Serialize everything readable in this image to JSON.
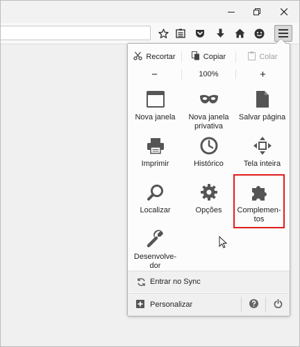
{
  "window": {
    "controls": {
      "minimize_icon": "minimize-icon",
      "restore_icon": "restore-icon",
      "close_icon": "close-icon"
    }
  },
  "toolbar": {
    "icons": [
      "star-icon",
      "reading-list-icon",
      "pocket-icon",
      "download-icon",
      "home-icon",
      "hello-icon",
      "hamburger-menu-icon"
    ]
  },
  "menu": {
    "edit": {
      "cut": "Recortar",
      "copy": "Copiar",
      "paste": "Colar"
    },
    "zoom": {
      "minus": "−",
      "value": "100%",
      "plus": "+"
    },
    "items": [
      {
        "label": "Nova janela",
        "icon": "window-icon"
      },
      {
        "label": "Nova janela\nprivativa",
        "icon": "mask-icon"
      },
      {
        "label": "Salvar página",
        "icon": "page-icon"
      },
      {
        "label": "Imprimir",
        "icon": "printer-icon"
      },
      {
        "label": "Histórico",
        "icon": "clock-icon"
      },
      {
        "label": "Tela inteira",
        "icon": "fullscreen-icon"
      },
      {
        "label": "Localizar",
        "icon": "magnifier-icon"
      },
      {
        "label": "Opções",
        "icon": "gear-icon"
      },
      {
        "label": "Complemen-\ntos",
        "icon": "puzzle-icon"
      },
      {
        "label": "Desenvolve-\ndor",
        "icon": "wrench-icon"
      }
    ],
    "sync": "Entrar no Sync",
    "customize": "Personalizar"
  },
  "colors": {
    "highlight": "#e01b1b",
    "icon": "#555555"
  }
}
